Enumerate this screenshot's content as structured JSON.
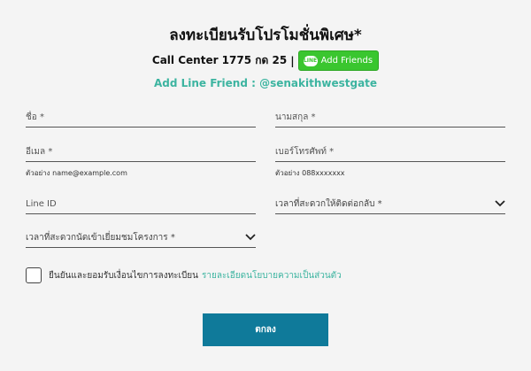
{
  "header": {
    "title": "ลงทะเบียนรับโปรโมชั่นพิเศษ*",
    "call_center": "Call Center 1775 กด 25",
    "separator": "|",
    "line_button_label": "Add Friends",
    "line_logo_text": "LINE",
    "add_line_friend": "Add Line Friend : @senakithwestgate"
  },
  "form": {
    "first_name_placeholder": "ชื่อ *",
    "last_name_placeholder": "นามสกุล *",
    "email_placeholder": "อีเมล *",
    "email_hint": "ตัวอย่าง name@example.com",
    "phone_placeholder": "เบอร์โทรศัพท์ *",
    "phone_hint": "ตัวอย่าง 088xxxxxxx",
    "line_id_placeholder": "Line ID",
    "contact_time_label": "เวลาที่สะดวกให้ติดต่อกลับ *",
    "visit_time_label": "เวลาที่สะดวกนัดเข้าเยี่ยมชมโครงการ *",
    "consent_text": "ยืนยันและยอมรับเงื่อนไขการลงทะเบียน",
    "consent_link": "รายละเอียดนโยบายความเป็นส่วนตัว",
    "submit_label": "ตกลง"
  },
  "colors": {
    "accent_teal": "#3cb4a0",
    "button_blue": "#0f7a9a",
    "line_green": "#3ac62f"
  }
}
